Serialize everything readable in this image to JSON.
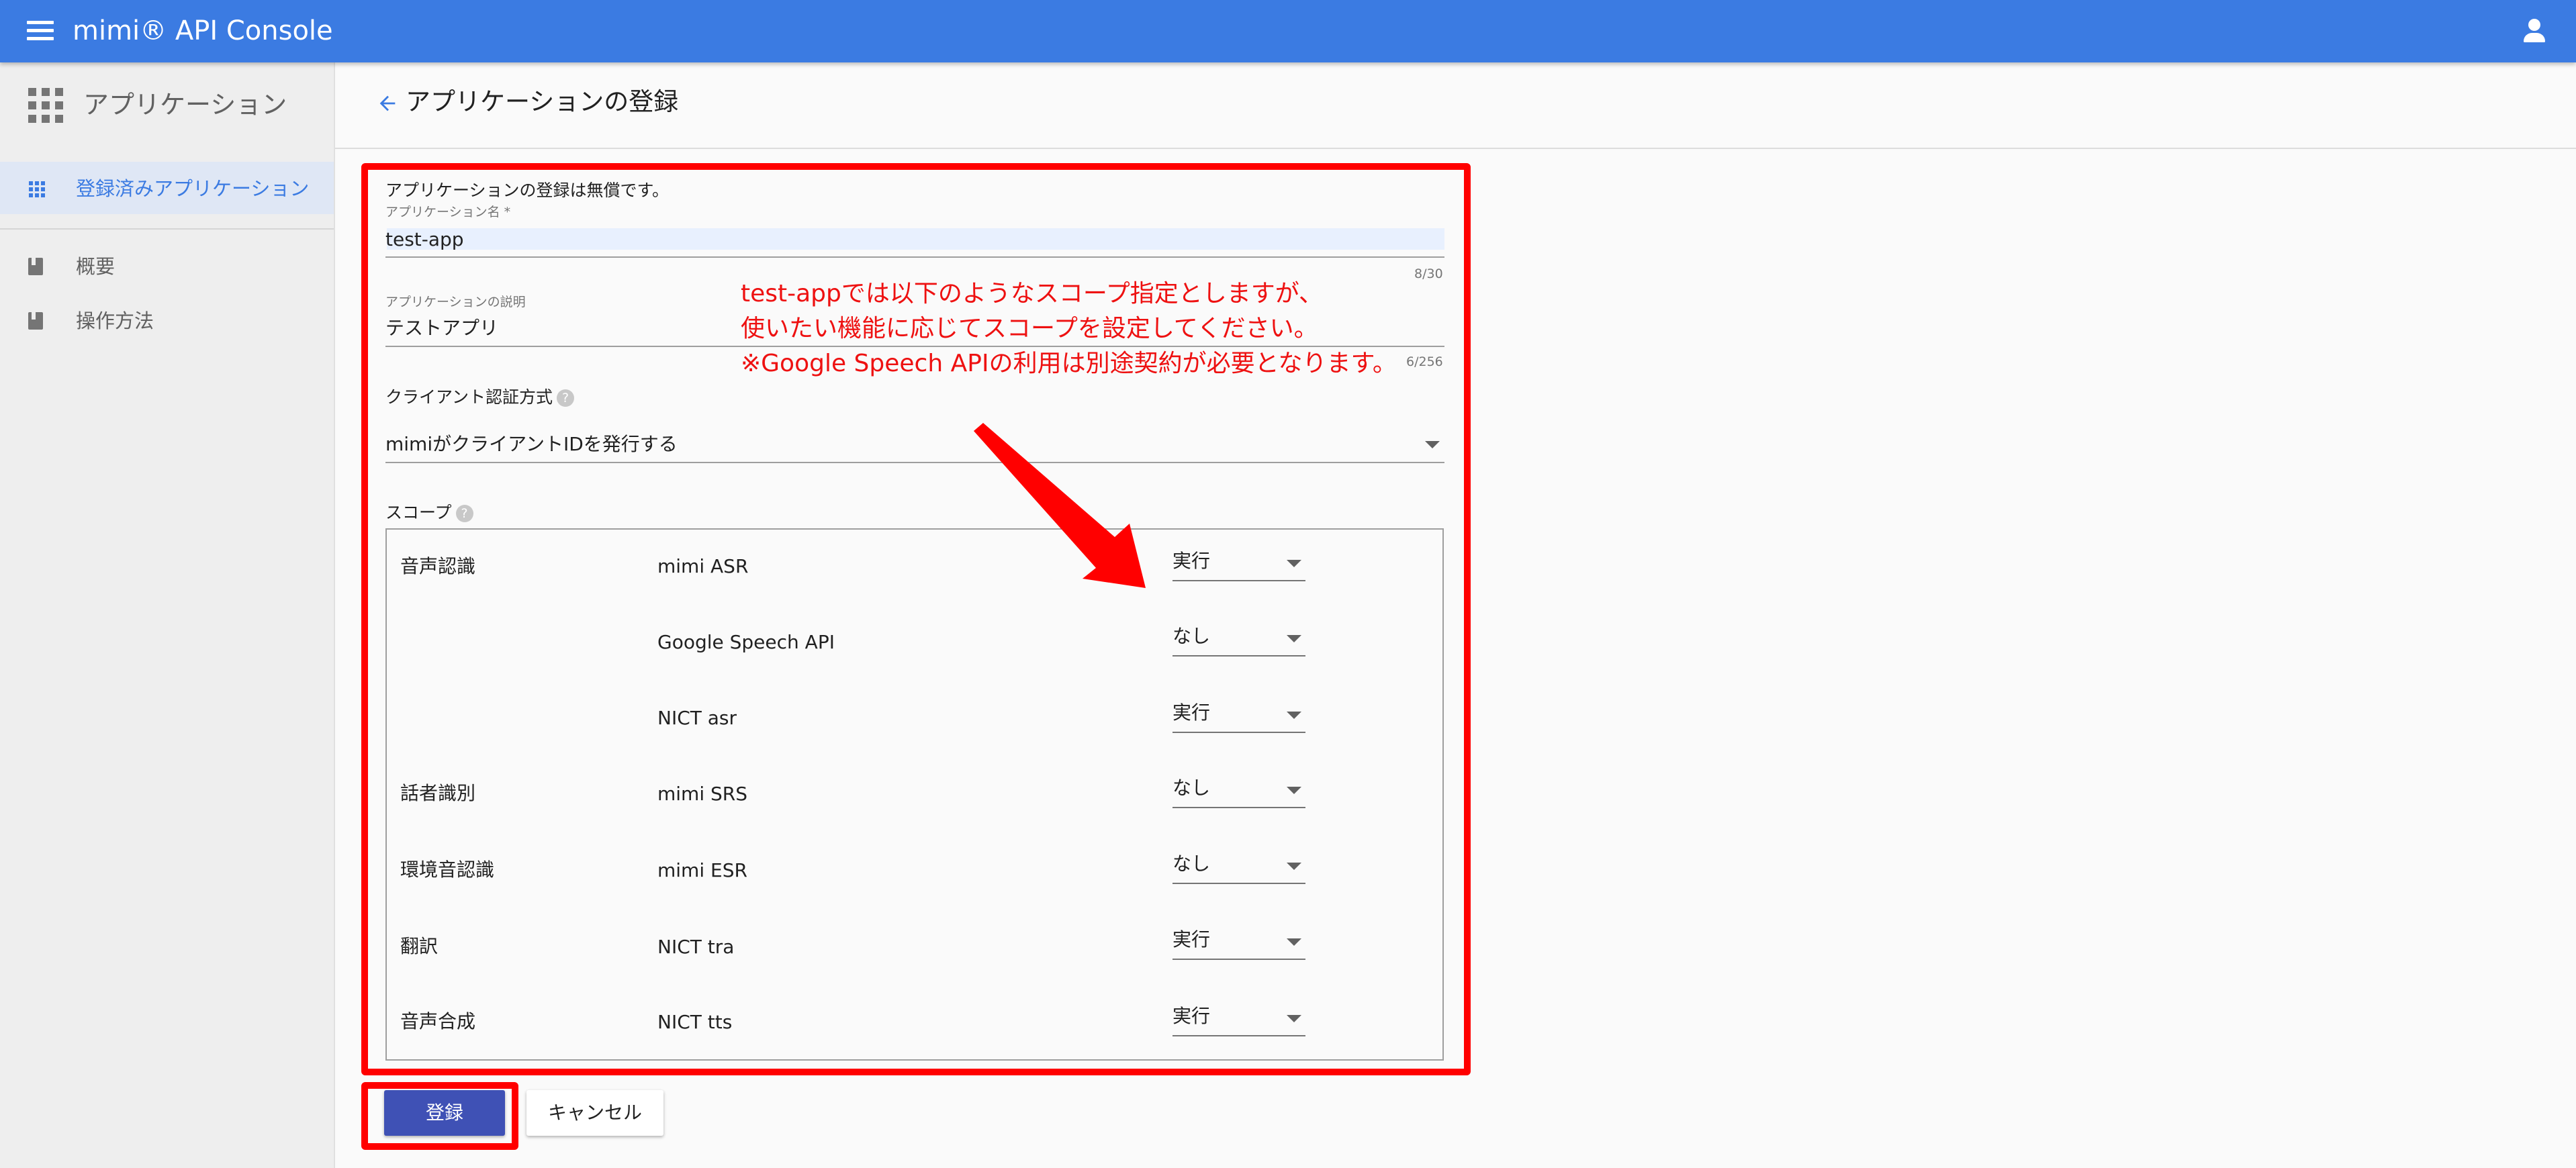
{
  "colors": {
    "primary": "#3b7be2",
    "accent_button": "#3f51b5",
    "annotation_red": "#ff0000"
  },
  "topbar": {
    "title": "mimi® API Console",
    "menu_icon": "menu-icon",
    "account_icon": "account-icon"
  },
  "sidebar": {
    "header": "アプリケーション",
    "active_item": "登録済みアプリケーション",
    "items": [
      {
        "label": "概要"
      },
      {
        "label": "操作方法"
      }
    ]
  },
  "page": {
    "title": "アプリケーションの登録"
  },
  "form": {
    "notice": "アプリケーションの登録は無償です。",
    "app_name": {
      "label": "アプリケーション名 *",
      "value": "test-app",
      "counter": "8/30"
    },
    "app_desc": {
      "label": "アプリケーションの説明",
      "value": "テストアプリ",
      "counter": "6/256"
    },
    "auth": {
      "label": "クライアント認証方式",
      "value": "mimiがクライアントIDを発行する"
    },
    "scope_label": "スコープ",
    "help_glyph": "?",
    "scopes": [
      {
        "category": "音声認識",
        "api": "mimi ASR",
        "value": "実行"
      },
      {
        "category": "",
        "api": "Google Speech API",
        "value": "なし"
      },
      {
        "category": "",
        "api": "NICT asr",
        "value": "実行"
      },
      {
        "category": "話者識別",
        "api": "mimi SRS",
        "value": "なし"
      },
      {
        "category": "環境音認識",
        "api": "mimi ESR",
        "value": "なし"
      },
      {
        "category": "翻訳",
        "api": "NICT tra",
        "value": "実行"
      },
      {
        "category": "音声合成",
        "api": "NICT tts",
        "value": "実行"
      }
    ]
  },
  "annotation": {
    "lines": [
      "test-appでは以下のようなスコープ指定としますが、",
      "使いたい機能に応じてスコープを設定してください。",
      "※Google Speech APIの利用は別途契約が必要となります。"
    ]
  },
  "buttons": {
    "submit": "登録",
    "cancel": "キャンセル"
  }
}
